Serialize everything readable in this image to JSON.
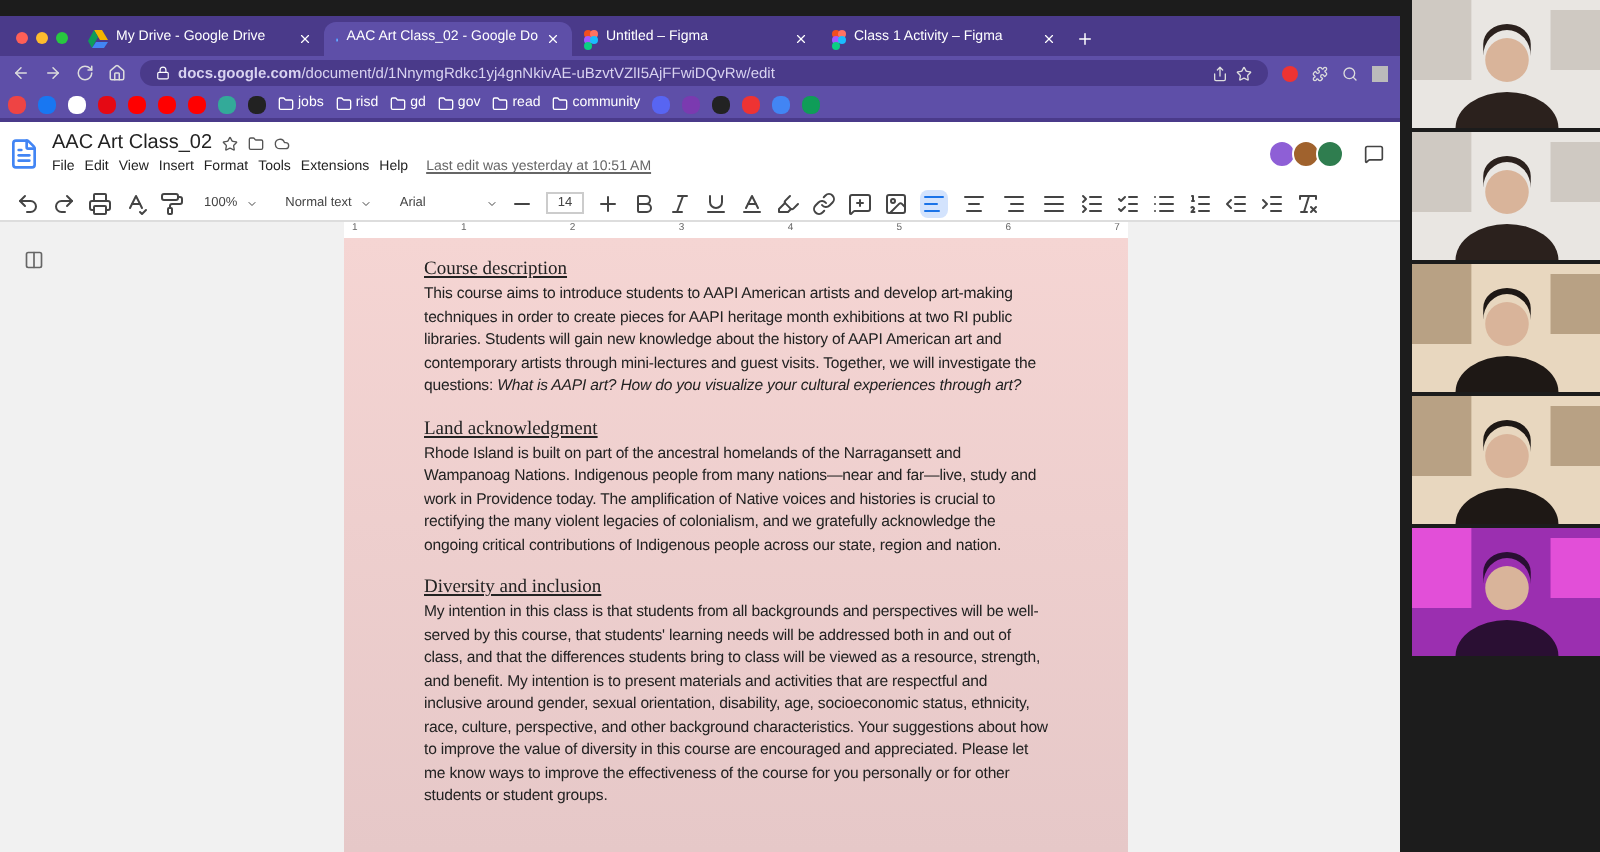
{
  "browser": {
    "tabs": [
      {
        "title": "My Drive - Google Drive",
        "selected": false
      },
      {
        "title": "AAC Art Class_02 - Google Do",
        "selected": true
      },
      {
        "title": "Untitled – Figma",
        "selected": false
      },
      {
        "title": "Class 1 Activity – Figma",
        "selected": false
      }
    ],
    "url": "**docs.google.com**/document/d/1NnymgRdkc1yj4gnNkivAE-uBzvtVZlI5AjFFwiDQvRw/edit",
    "bookmarks": [
      {
        "label": "jobs"
      },
      {
        "label": "risd"
      },
      {
        "label": "gd"
      },
      {
        "label": "gov"
      },
      {
        "label": "read"
      },
      {
        "label": "community"
      }
    ]
  },
  "docs": {
    "title": "AAC Art Class_02",
    "menu": [
      "File",
      "Edit",
      "View",
      "Insert",
      "Format",
      "Tools",
      "Extensions",
      "Help"
    ],
    "last_edit": "Last edit was yesterday at 10:51 AM",
    "collaborators": [
      {
        "color": "#8e5fd6"
      },
      {
        "color": "#a0622d"
      },
      {
        "color": "#2f7d4f"
      }
    ],
    "toolbar": {
      "zoom": "100%",
      "style": "Normal text",
      "font": "Arial",
      "font_size": "14",
      "alignments": [
        {
          "selected": true
        },
        {
          "selected": false
        },
        {
          "selected": false
        },
        {
          "selected": false
        }
      ]
    },
    "ruler": [
      "1",
      "1",
      "2",
      "3",
      "4",
      "5",
      "6",
      "7"
    ],
    "sections": [
      {
        "heading": "Course description",
        "body": "This course aims to introduce students to AAPI American artists and develop art-making techniques in order to create pieces for AAPI heritage month exhibitions at two RI public libraries. Students will gain new knowledge about the history of AAPI American art and contemporary artists through mini-lectures and guest visits. Together, we will investigate the questions: *What is AAPI art? How do you visualize your cultural experiences through art?*"
      },
      {
        "heading": "Land acknowledgment",
        "body": "Rhode Island is built on part of the ancestral homelands of the Narragansett and Wampanoag Nations. Indigenous people from many nations—near and far—live, study and work in Providence today. The amplification of Native voices and histories is crucial to rectifying the many violent legacies of colonialism, and we gratefully acknowledge the ongoing critical contributions of Indigenous people across our state, region and nation."
      },
      {
        "heading": "Diversity and inclusion",
        "body": "My intention in this class is that students from all backgrounds and perspectives will be well-served by this course, that students' learning needs will be addressed both in and out of class, and that the differences students bring to class will be viewed as a resource, strength, and benefit. My intention is to present materials and activities that are respectful and inclusive around gender, sexual orientation, disability, age, socioeconomic status, ethnicity, race, culture, perspective, and other background characteristics. Your suggestions about how to improve the value of diversity in this course are encouraged and appreciated. Please let me know ways to improve the effectiveness of the course for you personally or for other students or student groups."
      }
    ]
  }
}
